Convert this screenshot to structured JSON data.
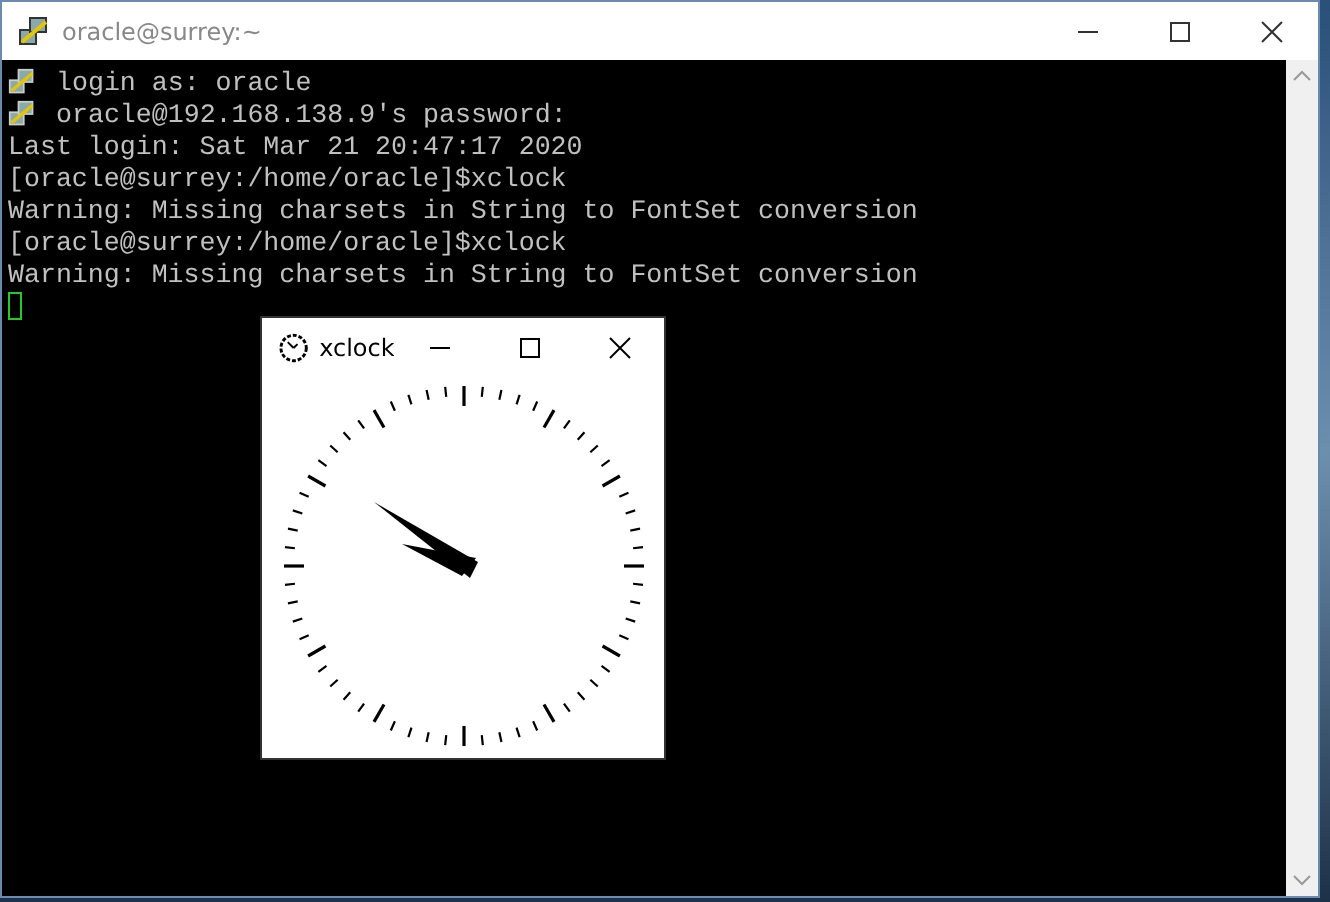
{
  "window": {
    "title": "oracle@surrey:~"
  },
  "terminal": {
    "lines": [
      {
        "kind": "info",
        "text": "login as: oracle"
      },
      {
        "kind": "info",
        "text": "oracle@192.168.138.9's password:"
      },
      {
        "kind": "plain",
        "text": "Last login: Sat Mar 21 20:47:17 2020"
      },
      {
        "kind": "plain",
        "text": "[oracle@surrey:/home/oracle]$xclock"
      },
      {
        "kind": "plain",
        "text": "Warning: Missing charsets in String to FontSet conversion"
      },
      {
        "kind": "plain",
        "text": "[oracle@surrey:/home/oracle]$xclock"
      },
      {
        "kind": "plain",
        "text": "Warning: Missing charsets in String to FontSet conversion"
      }
    ]
  },
  "xclock": {
    "title": "xclock"
  }
}
